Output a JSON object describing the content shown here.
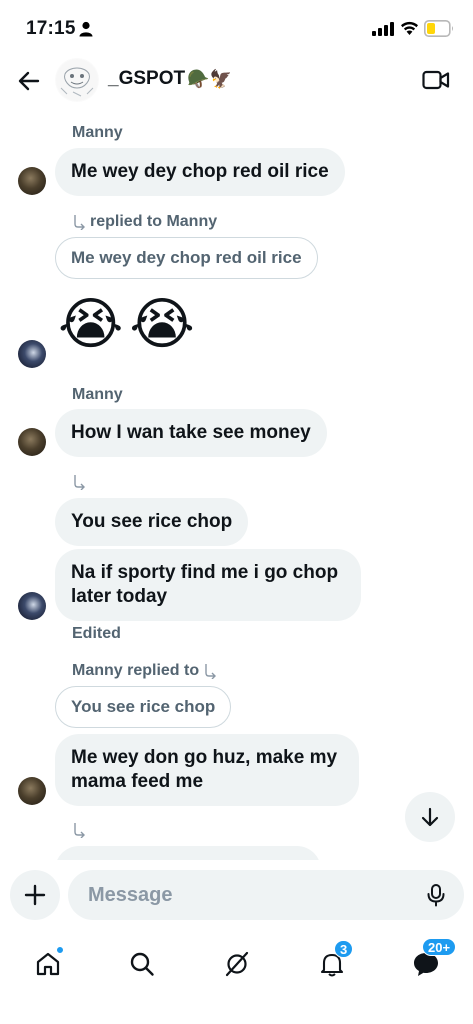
{
  "status_bar": {
    "time": "17:15"
  },
  "header": {
    "title": "_GSPOT",
    "title_emojis": "🪖🦅"
  },
  "messages": {
    "m1_sender": "Manny",
    "m1_text": "Me wey dey chop red oil rice",
    "reply1_label": "replied to Manny",
    "reply1_quote": "Me wey dey chop red oil rice",
    "emoji_msg": "😭😭",
    "m2_sender": "Manny",
    "m2_text": "How I wan take see money",
    "m3_text": "You see rice chop",
    "m4_text": "Na if sporty find me i go chop later today",
    "edited": "Edited",
    "reply2_label": "Manny replied to",
    "reply2_quote": "You see rice chop",
    "m5_text": "Me wey don go huz, make my mama feed me"
  },
  "composer": {
    "placeholder": "Message"
  },
  "nav": {
    "notifications_badge": "3",
    "messages_badge": "20+"
  },
  "colors": {
    "accent": "#1d9bf0",
    "bubble": "#eff3f4",
    "secondary_text": "#536471"
  },
  "icons": [
    "back-arrow-icon",
    "video-call-icon",
    "reply-icon",
    "scroll-down-icon",
    "plus-icon",
    "microphone-icon",
    "home-icon",
    "search-icon",
    "grok-icon",
    "bell-icon",
    "messages-icon"
  ]
}
